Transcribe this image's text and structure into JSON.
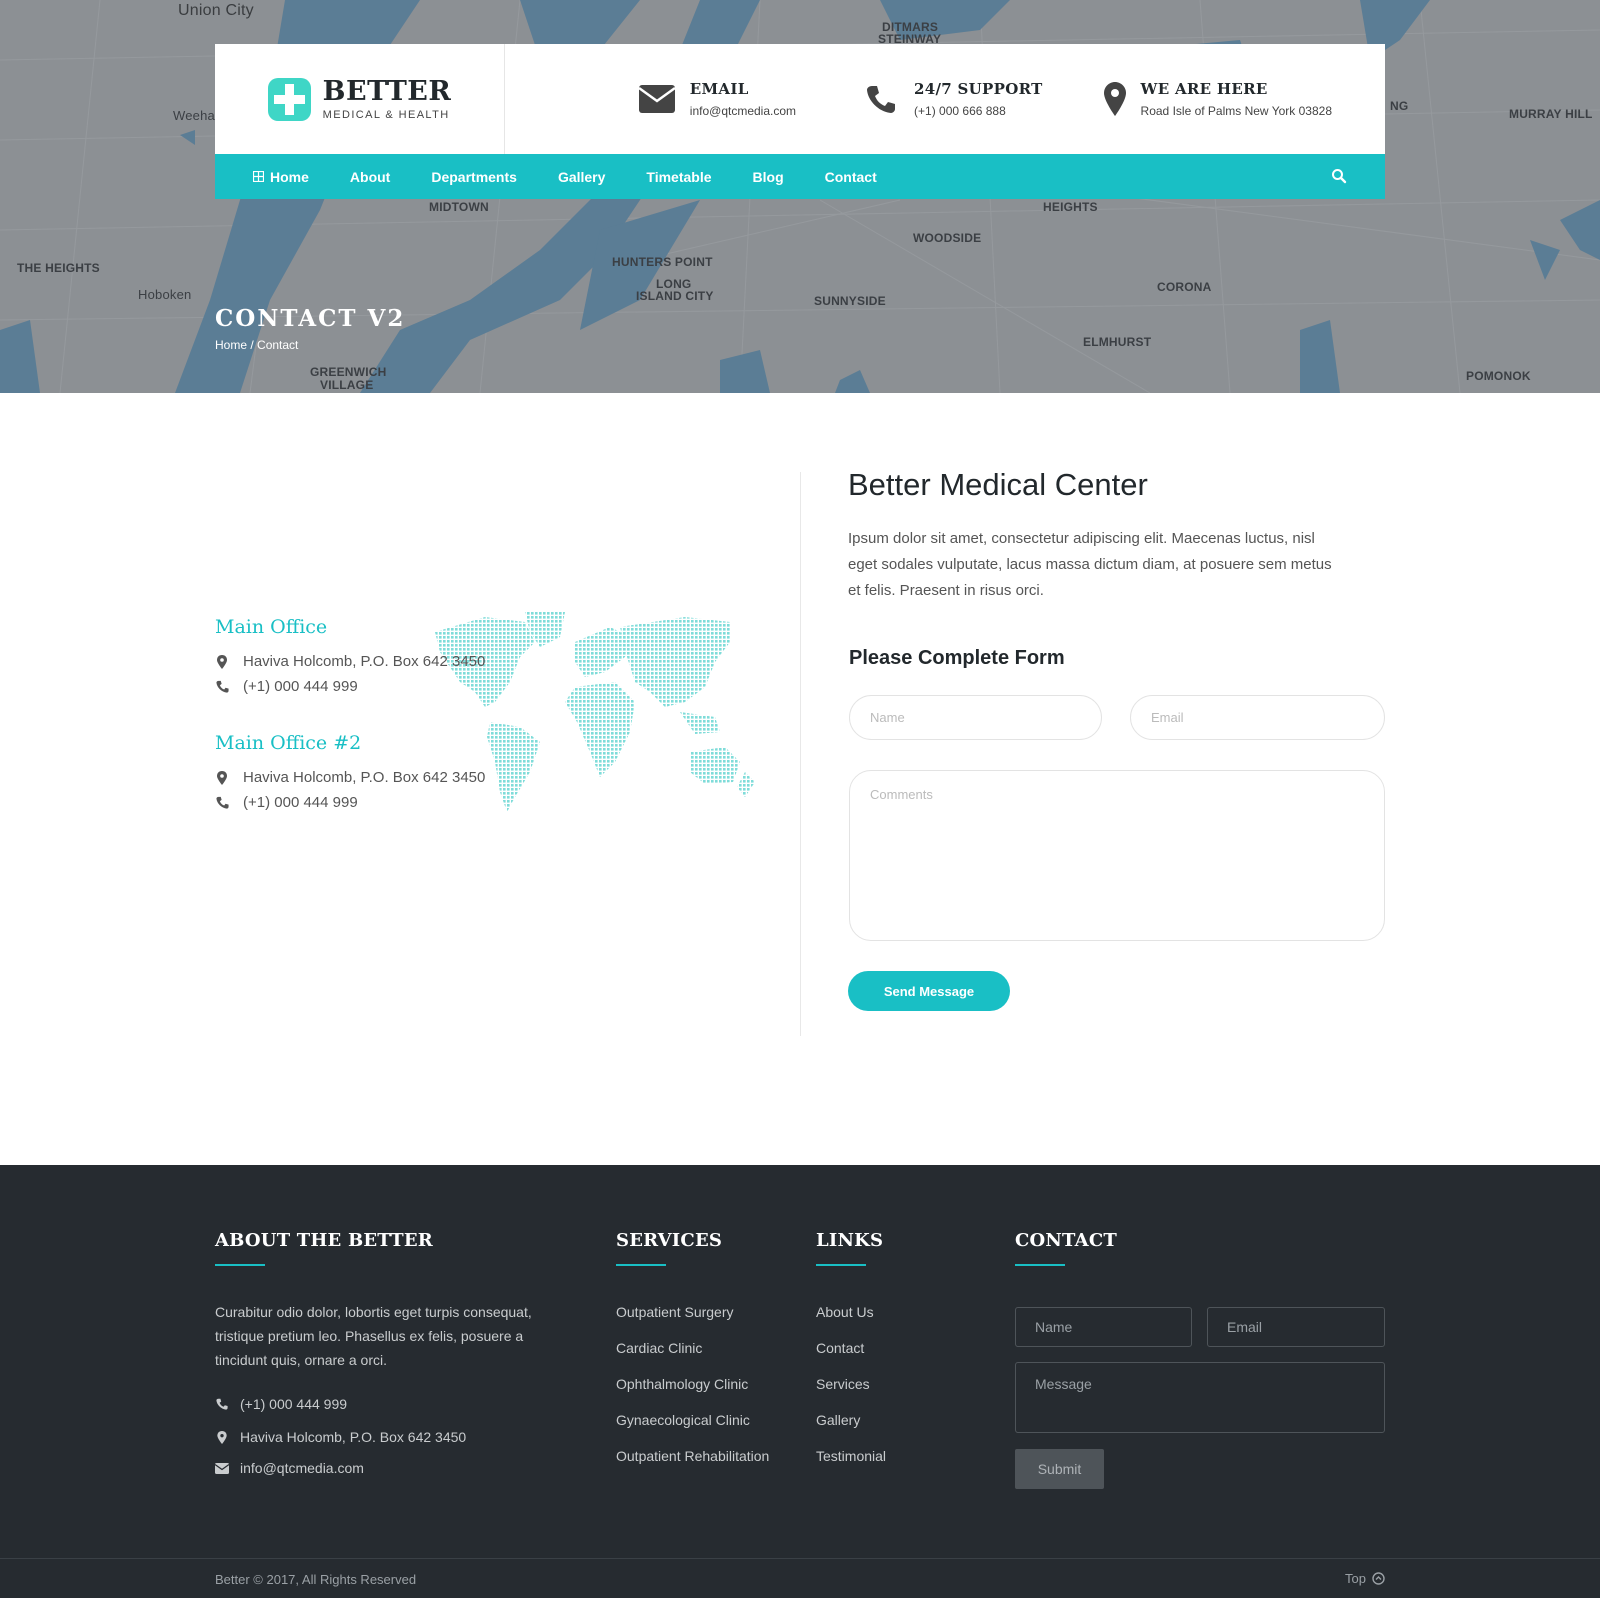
{
  "colors": {
    "accent": "#19bfc5",
    "footer_bg": "#262b30",
    "map_land": "#8a8f94",
    "map_water": "#5d7e96"
  },
  "map_labels": {
    "union_city": "Union City",
    "weehawken": "Weeha",
    "the_heights": "THE HEIGHTS",
    "hoboken": "Hoboken",
    "greenwich": "GREENWICH",
    "village": "VILLAGE",
    "midtown": "MIDTOWN",
    "hunters_point": "HUNTERS POINT",
    "long": "LONG",
    "island_city": "ISLAND CITY",
    "sunnyside": "SUNNYSIDE",
    "woodside": "WOODSIDE",
    "ditmars": "DITMARS",
    "steinway": "STEINWAY",
    "heights": "HEIGHTS",
    "corona": "CORONA",
    "elmhurst": "ELMHURST",
    "murray_hill": "MURRAY HILL",
    "pomonok": "POMONOK",
    "ng": "NG"
  },
  "brand": {
    "name": "BETTER",
    "tagline": "MEDICAL & HEALTH"
  },
  "header_info": [
    {
      "icon": "envelope-icon",
      "title": "EMAIL",
      "text": "info@qtcmedia.com"
    },
    {
      "icon": "phone-icon",
      "title": "24/7 SUPPORT",
      "text": "(+1) 000 666 888"
    },
    {
      "icon": "map-pin-icon",
      "title": "WE ARE HERE",
      "text": "Road Isle of Palms New York 03828"
    }
  ],
  "nav": {
    "items": [
      "Home",
      "About",
      "Departments",
      "Gallery",
      "Timetable",
      "Blog",
      "Contact"
    ]
  },
  "page": {
    "title": "CONTACT V2",
    "breadcrumb_home": "Home",
    "breadcrumb_sep": " / ",
    "breadcrumb_current": "Contact"
  },
  "offices": [
    {
      "title": "Main Office",
      "address": "Haviva Holcomb, P.O. Box 642 3450",
      "phone": "(+1) 000 444 999"
    },
    {
      "title": "Main Office #2",
      "address": "Haviva Holcomb, P.O. Box 642 3450",
      "phone": "(+1) 000 444 999"
    }
  ],
  "center": {
    "title": "Better Medical Center",
    "description": "Ipsum dolor sit amet, consectetur adipiscing elit. Maecenas luctus, nisl eget sodales vulputate, lacus massa dictum diam, at posuere sem metus et felis. Praesent in risus orci.",
    "form_title": "Please Complete Form",
    "name_placeholder": "Name",
    "email_placeholder": "Email",
    "comments_placeholder": "Comments",
    "send_label": "Send Message"
  },
  "footer": {
    "about_title": "ABOUT THE BETTER",
    "about_text": "Curabitur odio dolor, lobortis eget turpis consequat, tristique pretium leo. Phasellus ex felis, posuere a tincidunt quis, ornare a orci.",
    "phone": "(+1) 000 444 999",
    "address": "Haviva Holcomb, P.O. Box 642 3450",
    "email": "info@qtcmedia.com",
    "services_title": "SERVICES",
    "services": [
      "Outpatient Surgery",
      "Cardiac Clinic",
      "Ophthalmology Clinic",
      "Gynaecological Clinic",
      "Outpatient Rehabilitation"
    ],
    "links_title": "LINKS",
    "links": [
      "About Us",
      "Contact",
      "Services",
      "Gallery",
      "Testimonial"
    ],
    "contact_title": "CONTACT",
    "name_placeholder": "Name",
    "email_placeholder": "Email",
    "message_placeholder": "Message",
    "submit_label": "Submit",
    "copyright": "Better © 2017, All Rights Reserved",
    "top_label": "Top"
  }
}
